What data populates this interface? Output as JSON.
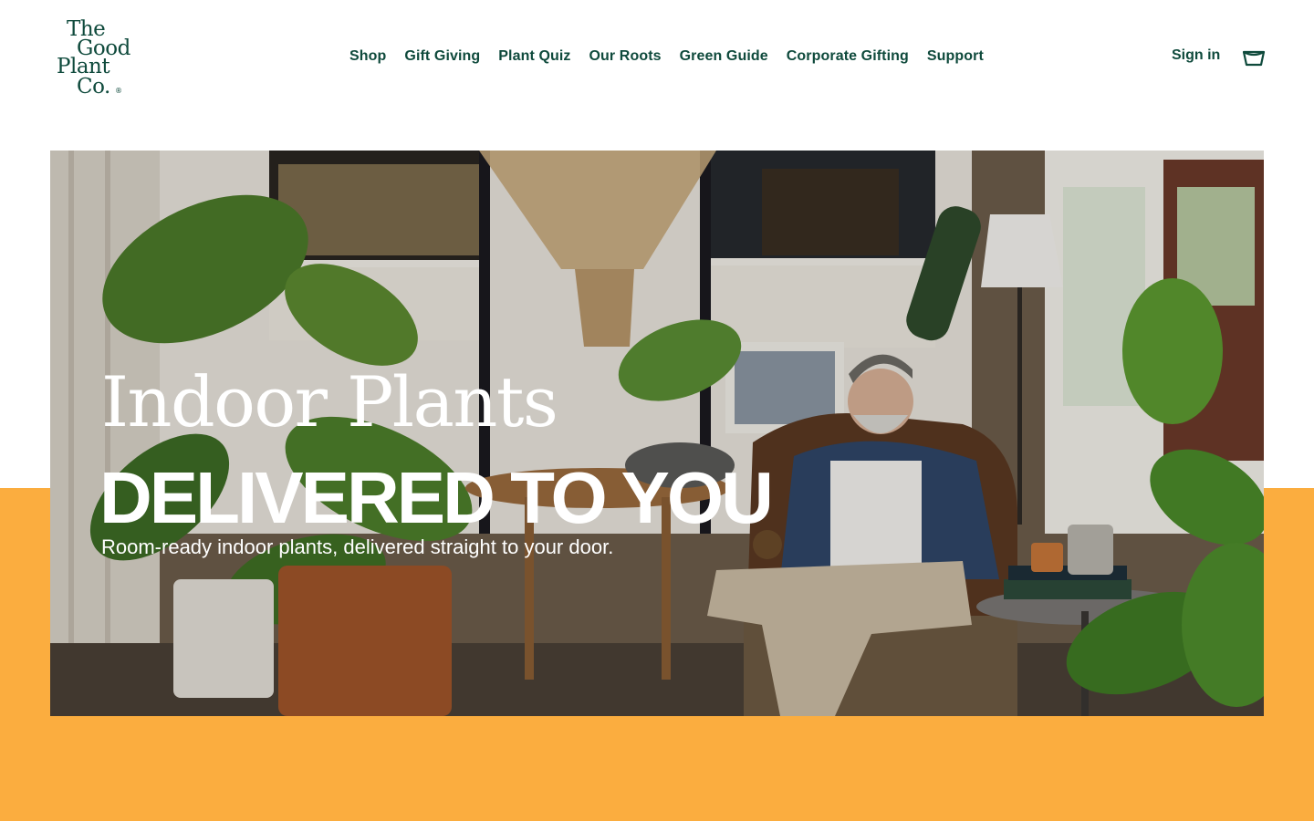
{
  "brand": {
    "logo_lines": [
      "The",
      "Good",
      "Plant",
      "Co."
    ],
    "registered_mark": "®",
    "primary_color": "#0f4a3c",
    "accent_color": "#fbad3f"
  },
  "nav": {
    "items": [
      {
        "label": "Shop"
      },
      {
        "label": "Gift Giving"
      },
      {
        "label": "Plant Quiz"
      },
      {
        "label": "Our Roots"
      },
      {
        "label": "Green Guide"
      },
      {
        "label": "Corporate Gifting"
      },
      {
        "label": "Support"
      }
    ]
  },
  "account": {
    "sign_in_label": "Sign in",
    "cart_icon": "shopping-bag-icon"
  },
  "hero": {
    "title_line_1": "Indoor Plants",
    "title_line_2": "DELIVERED TO YOU",
    "subtitle": "Room-ready indoor plants, delivered straight to your door.",
    "image_alt": "Man relaxing in an armchair surrounded by indoor plants"
  }
}
